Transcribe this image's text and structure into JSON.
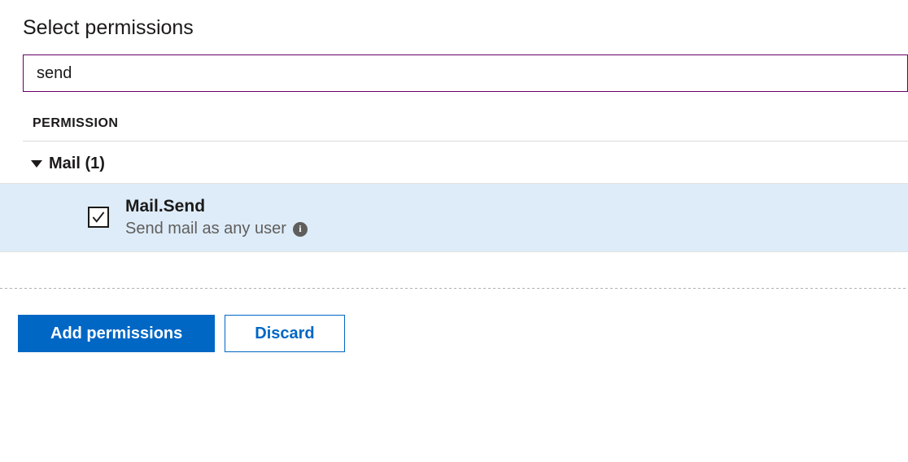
{
  "panel": {
    "title": "Select permissions",
    "search_value": "send",
    "column_header": "PERMISSION",
    "group": {
      "label": "Mail (1)",
      "items": [
        {
          "checked": true,
          "name": "Mail.Send",
          "description": "Send mail as any user"
        }
      ]
    }
  },
  "footer": {
    "primary_label": "Add permissions",
    "secondary_label": "Discard"
  }
}
